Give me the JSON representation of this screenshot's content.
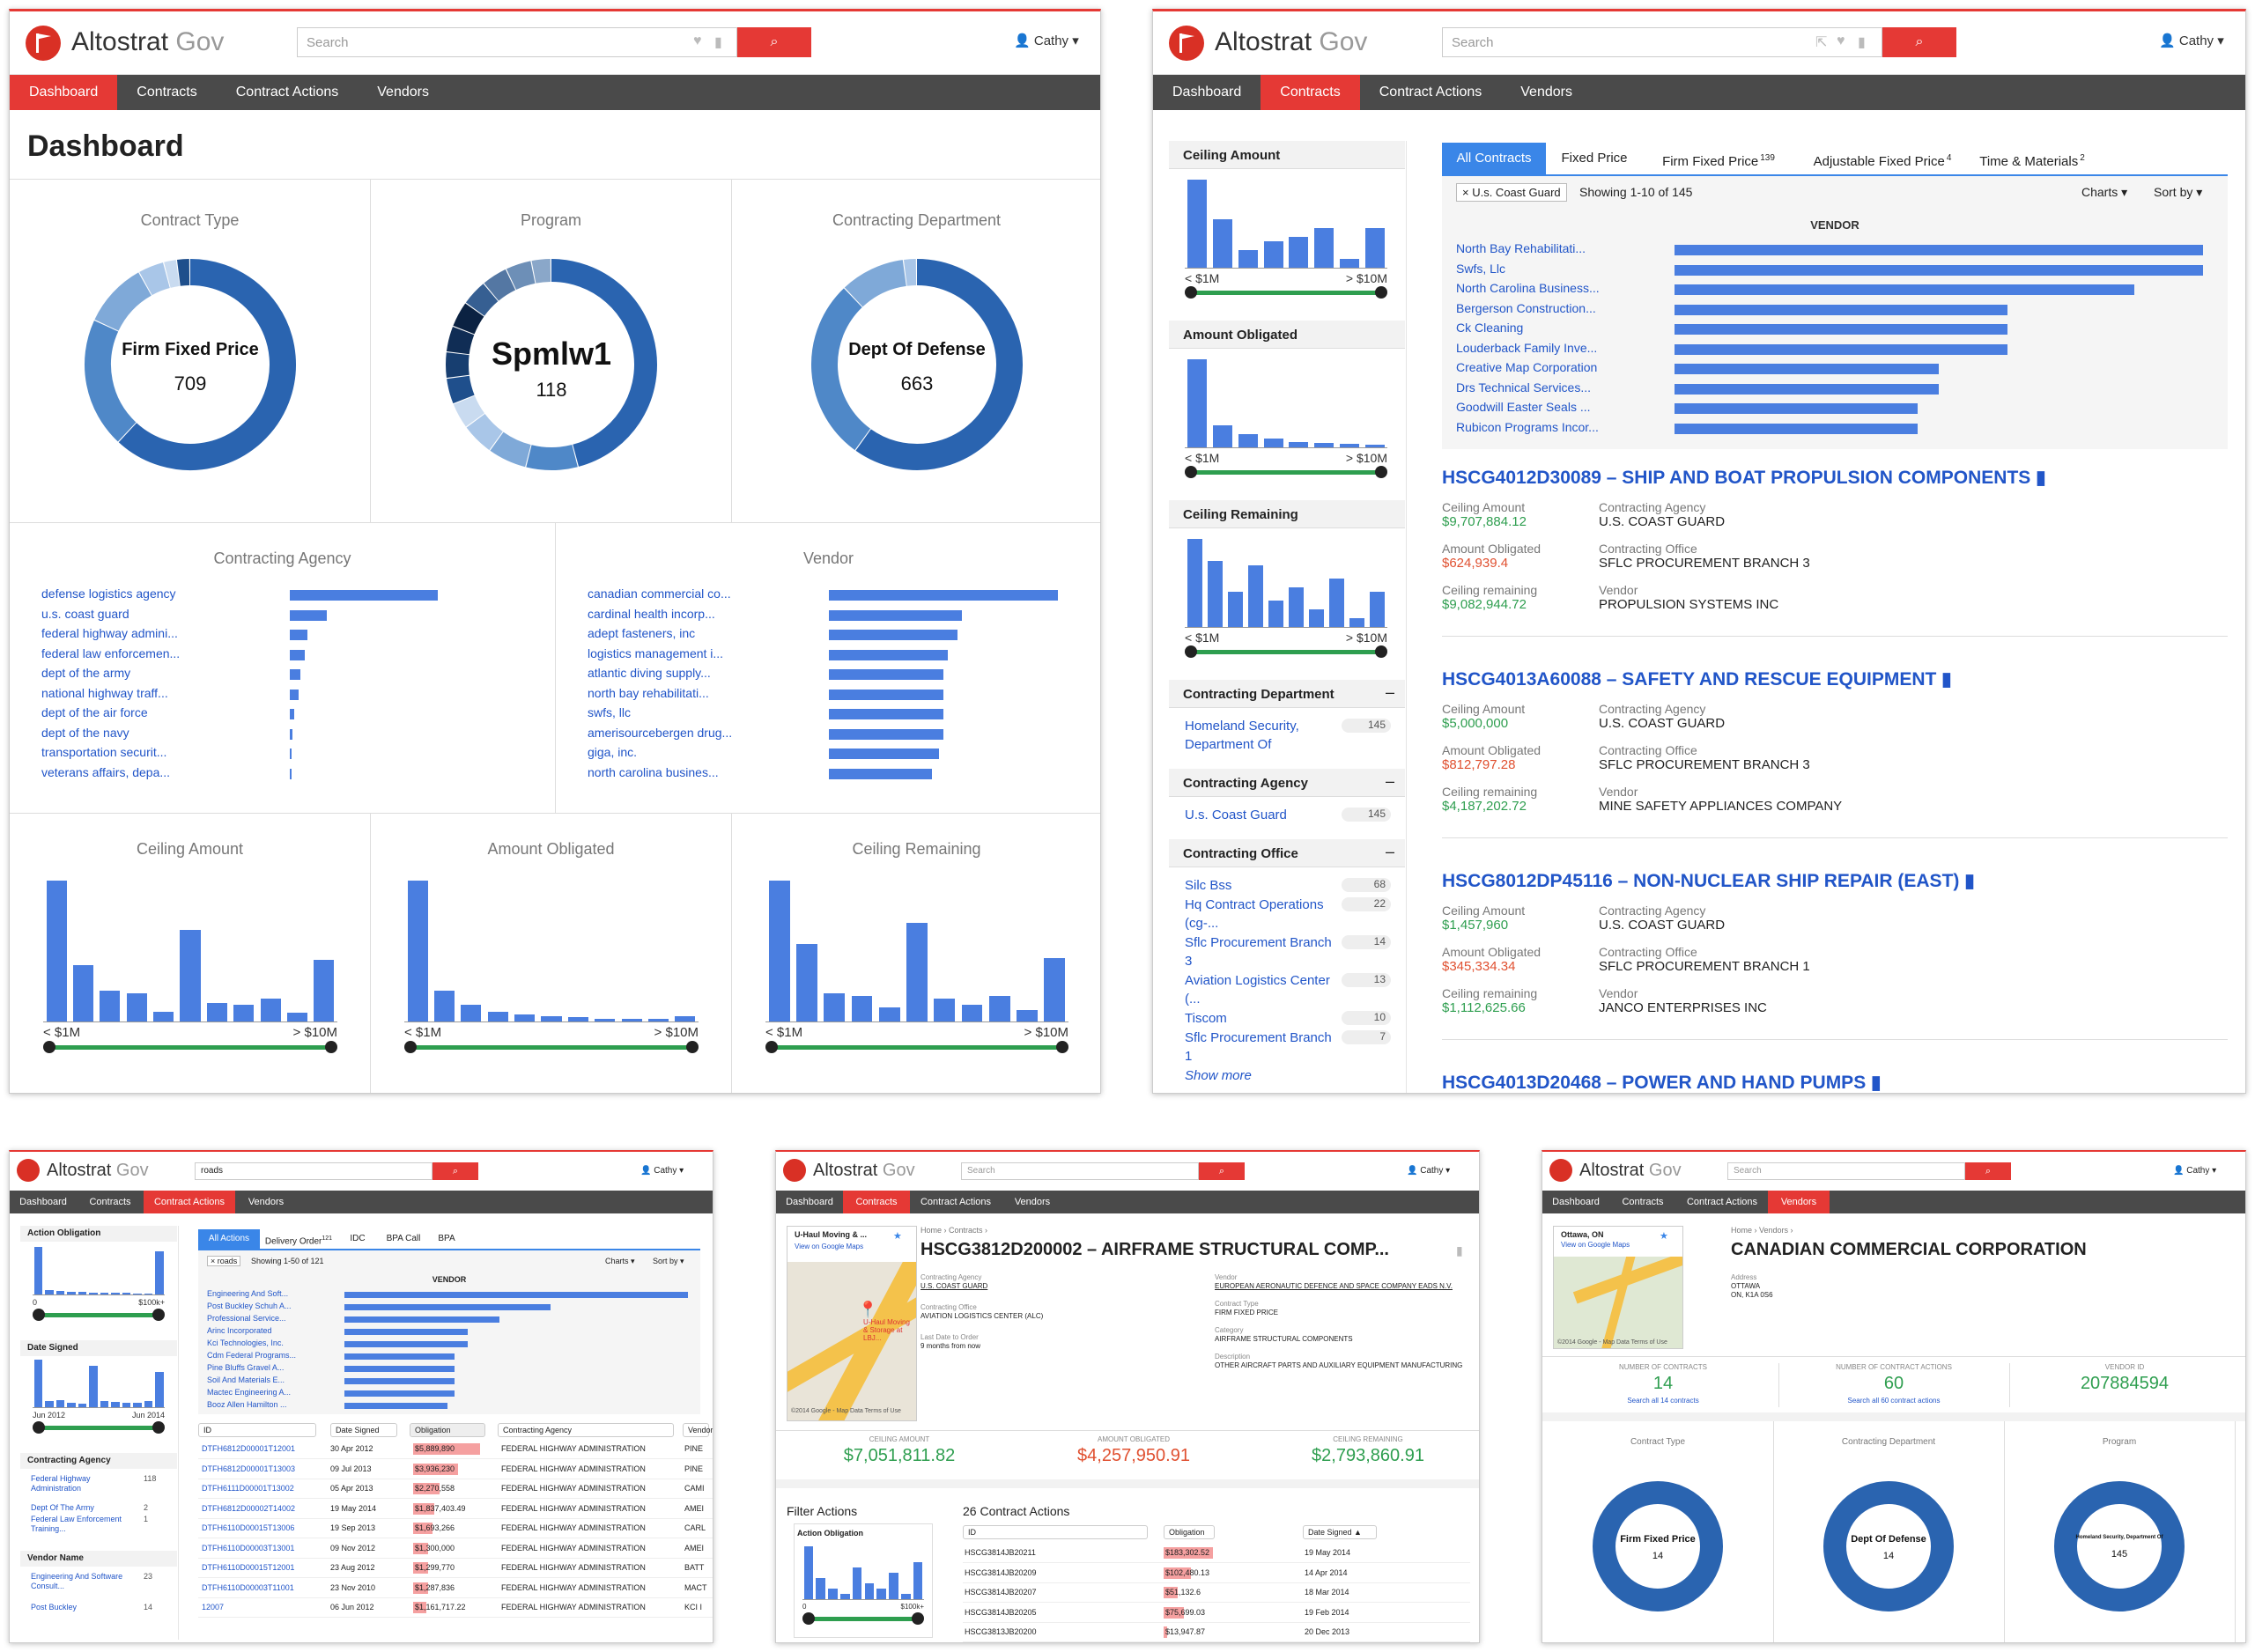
{
  "brand": {
    "name": "Altostrat",
    "suffix": "Gov"
  },
  "search_placeholder": "Search",
  "search_value": "roads",
  "user": "Cathy",
  "nav": [
    "Dashboard",
    "Contracts",
    "Contract Actions",
    "Vendors"
  ],
  "dashboard": {
    "title": "Dashboard",
    "donuts": [
      {
        "title": "Contract Type",
        "label": "Firm Fixed Price",
        "value": "709",
        "segments": [
          0.62,
          0.2,
          0.1,
          0.04,
          0.02,
          0.02
        ]
      },
      {
        "title": "Program",
        "label": "Spmlw1",
        "value": "118",
        "segments": [
          0.46,
          0.08,
          0.06,
          0.05,
          0.04,
          0.04,
          0.04,
          0.04,
          0.04,
          0.04,
          0.04,
          0.04,
          0.03
        ]
      },
      {
        "title": "Contracting Department",
        "label": "Dept Of Defense",
        "value": "663",
        "segments": [
          0.6,
          0.28,
          0.1,
          0.02
        ]
      }
    ],
    "agency": {
      "title": "Contracting Agency",
      "items": [
        "defense logistics agency",
        "u.s. coast guard",
        "federal highway admini...",
        "federal law enforcemen...",
        "dept of the army",
        "national highway traff...",
        "dept of the air force",
        "dept of the navy",
        "transportation securit...",
        "veterans affairs, depa..."
      ],
      "values": [
        1,
        0.25,
        0.12,
        0.1,
        0.07,
        0.06,
        0.03,
        0.02,
        0.01,
        0.005
      ]
    },
    "vendor": {
      "title": "Vendor",
      "items": [
        "canadian commercial co...",
        "cardinal health incorp...",
        "adept fasteners, inc",
        "logistics management i...",
        "atlantic diving supply...",
        "north bay rehabilitati...",
        "swfs, llc",
        "amerisourcebergen drug...",
        "giga, inc.",
        "north carolina busines..."
      ],
      "values": [
        1,
        0.58,
        0.56,
        0.52,
        0.5,
        0.5,
        0.5,
        0.5,
        0.48,
        0.45
      ]
    },
    "hists": [
      {
        "title": "Ceiling Amount",
        "values": [
          100,
          40,
          22,
          20,
          7,
          65,
          13,
          12,
          16,
          6,
          44
        ],
        "lo": "< $1M",
        "hi": "> $10M"
      },
      {
        "title": "Amount Obligated",
        "values": [
          100,
          22,
          12,
          7,
          5,
          4,
          3,
          2,
          2,
          2,
          4
        ],
        "lo": "< $1M",
        "hi": "> $10M"
      },
      {
        "title": "Ceiling Remaining",
        "values": [
          100,
          55,
          20,
          18,
          10,
          70,
          16,
          12,
          18,
          8,
          45
        ],
        "lo": "< $1M",
        "hi": "> $10M"
      }
    ]
  },
  "contracts": {
    "tabs": [
      "All Contracts",
      "Fixed Price",
      "Firm Fixed Price",
      "Adjustable Fixed Price",
      "Time & Materials"
    ],
    "tab_counts": [
      "",
      "",
      "139",
      "4",
      "2"
    ],
    "filter_chip": "U.s. Coast Guard",
    "showing": "Showing 1-10 of 145",
    "charts": "Charts",
    "sortby": "Sort by",
    "vendor_header": "VENDOR",
    "vendors": [
      "North Bay Rehabilitati...",
      "Swfs, Llc",
      "North Carolina Business...",
      "Bergerson Construction...",
      "Ck Cleaning",
      "Louderback Family Inve...",
      "Creative Map Corporation",
      "Drs Technical Services...",
      "Goodwill Easter Seals ...",
      "Rubicon Programs Incor..."
    ],
    "vendor_values": [
      1,
      1,
      0.87,
      0.63,
      0.63,
      0.63,
      0.5,
      0.5,
      0.46,
      0.46
    ],
    "side": {
      "hists": [
        {
          "title": "Ceiling Amount",
          "values": [
            100,
            55,
            20,
            30,
            35,
            45,
            10,
            45
          ],
          "lo": "< $1M",
          "hi": "> $10M"
        },
        {
          "title": "Amount Obligated",
          "values": [
            100,
            25,
            15,
            10,
            6,
            5,
            4,
            3
          ],
          "lo": "< $1M",
          "hi": "> $10M"
        },
        {
          "title": "Ceiling Remaining",
          "values": [
            100,
            75,
            40,
            70,
            30,
            45,
            20,
            55,
            10,
            40
          ],
          "lo": "< $1M",
          "hi": "> $10M"
        }
      ],
      "dept_title": "Contracting Department",
      "dept_items": [
        {
          "label": "Homeland Security, Department Of",
          "count": "145"
        }
      ],
      "agency_title": "Contracting Agency",
      "agency_items": [
        {
          "label": "U.s. Coast Guard",
          "count": "145"
        }
      ],
      "office_title": "Contracting Office",
      "office_items": [
        {
          "label": "Silc Bss",
          "count": "68"
        },
        {
          "label": "Hq Contract Operations (cg-...",
          "count": "22"
        },
        {
          "label": "Sflc Procurement Branch 3",
          "count": "14"
        },
        {
          "label": "Aviation Logistics Center (...",
          "count": "13"
        },
        {
          "label": "Tiscom",
          "count": "10"
        },
        {
          "label": "Sflc Procurement Branch 1",
          "count": "7"
        }
      ],
      "show_more": "Show more"
    },
    "records": [
      {
        "title": "HSCG4012D30089 – SHIP AND BOAT PROPULSION COMPONENTS",
        "ceiling": "$9,707,884.12",
        "obligated": "$624,939.4",
        "remaining": "$9,082,944.72",
        "agency": "U.S. COAST GUARD",
        "office": "SFLC PROCUREMENT BRANCH 3",
        "vendor": "PROPULSION SYSTEMS INC"
      },
      {
        "title": "HSCG4013A60088 – SAFETY AND RESCUE EQUIPMENT",
        "ceiling": "$5,000,000",
        "obligated": "$812,797.28",
        "remaining": "$4,187,202.72",
        "agency": "U.S. COAST GUARD",
        "office": "SFLC PROCUREMENT BRANCH 3",
        "vendor": "MINE SAFETY APPLIANCES COMPANY"
      },
      {
        "title": "HSCG8012DP45116 – NON-NUCLEAR SHIP REPAIR (EAST)",
        "ceiling": "$1,457,960",
        "obligated": "$345,334.34",
        "remaining": "$1,112,625.66",
        "agency": "U.S. COAST GUARD",
        "office": "SFLC PROCUREMENT BRANCH 1",
        "vendor": "JANCO ENTERPRISES INC"
      },
      {
        "title": "HSCG4013D20468 – POWER AND HAND PUMPS"
      }
    ],
    "lbl": {
      "ceiling": "Ceiling Amount",
      "obligated": "Amount Obligated",
      "remaining": "Ceiling remaining",
      "agency": "Contracting Agency",
      "office": "Contracting Office",
      "vendor": "Vendor"
    }
  },
  "actions": {
    "tabs": [
      "All Actions",
      "Delivery Order",
      "IDC",
      "BPA Call",
      "BPA"
    ],
    "tab_counts": [
      "",
      "121",
      "",
      "",
      ""
    ],
    "chip": "roads",
    "showing": "Showing 1-50 of 121",
    "charts": "Charts",
    "sortby": "Sort by",
    "vendor_header": "VENDOR",
    "vendors": [
      "Engineering And Soft...",
      "Post Buckley Schuh A...",
      "Professional Service...",
      "Arinc Incorporated",
      "Kci Technologies, Inc.",
      "Cdm Federal Programs...",
      "Pine Bluffs Gravel A...",
      "Soil And Materials E...",
      "Mactec Engineering A...",
      "Booz Allen Hamilton ..."
    ],
    "vendor_values": [
      1,
      0.6,
      0.45,
      0.36,
      0.36,
      0.32,
      0.32,
      0.32,
      0.32,
      0.3
    ],
    "side_hist1": {
      "title": "Action Obligation",
      "values": [
        100,
        10,
        8,
        6,
        5,
        4,
        4,
        3,
        3,
        2,
        2,
        90
      ],
      "lo": "0",
      "hi": "$100k+"
    },
    "side_hist2": {
      "title": "Date Signed",
      "values": [
        80,
        10,
        12,
        8,
        6,
        70,
        10,
        9,
        8,
        7,
        10,
        60
      ],
      "lo": "Jun 2012",
      "hi": "Jun 2014"
    },
    "side_agency_title": "Contracting Agency",
    "side_agency": [
      {
        "label": "Federal Highway Administration",
        "count": "118"
      },
      {
        "label": "Dept Of The Army",
        "count": "2"
      },
      {
        "label": "Federal Law Enforcement Training...",
        "count": "1"
      }
    ],
    "side_vendor_title": "Vendor Name",
    "side_vendor": [
      {
        "label": "Engineering And Software Consult...",
        "count": "23"
      },
      {
        "label": "Post Buckley",
        "count": "14"
      }
    ],
    "cols": [
      "ID",
      "Date Signed",
      "Obligation",
      "Contracting Agency",
      "Vendor"
    ],
    "rows": [
      [
        "DTFH6812D00001T12001",
        "30 Apr 2012",
        "$5,889,890",
        "FEDERAL HIGHWAY ADMINISTRATION",
        "PINE"
      ],
      [
        "DTFH6812D00001T13003",
        "09 Jul 2013",
        "$3,936,230",
        "FEDERAL HIGHWAY ADMINISTRATION",
        "PINE"
      ],
      [
        "DTFH6111D00001T13002",
        "05 Apr 2013",
        "$2,270,558",
        "FEDERAL HIGHWAY ADMINISTRATION",
        "CAMI"
      ],
      [
        "DTFH6812D00002T14002",
        "19 May 2014",
        "$1,837,403.49",
        "FEDERAL HIGHWAY ADMINISTRATION",
        "AMEI"
      ],
      [
        "DTFH6110D00015T13006",
        "19 Sep 2013",
        "$1,693,266",
        "FEDERAL HIGHWAY ADMINISTRATION",
        "CARL"
      ],
      [
        "DTFH6110D00003T13001",
        "09 Nov 2012",
        "$1,300,000",
        "FEDERAL HIGHWAY ADMINISTRATION",
        "AMEI"
      ],
      [
        "DTFH6110D00015T12001",
        "23 Aug 2012",
        "$1,299,770",
        "FEDERAL HIGHWAY ADMINISTRATION",
        "BATT"
      ],
      [
        "DTFH6110D00003T11001",
        "23 Nov 2010",
        "$1,287,836",
        "FEDERAL HIGHWAY ADMINISTRATION",
        "MACT"
      ],
      [
        "12007",
        "06 Jun 2012",
        "$1,161,717.22",
        "FEDERAL HIGHWAY ADMINISTRATION",
        "KCI I"
      ]
    ],
    "obl_values": [
      1,
      0.67,
      0.39,
      0.31,
      0.29,
      0.22,
      0.22,
      0.22,
      0.2
    ]
  },
  "detail": {
    "map_title": "U-Haul Moving & ...",
    "map_link": "View on Google Maps",
    "map_pin": "U-Haul Moving & Storage at LBJ...",
    "map_credit": "©2014 Google - Map Data   Terms of Use",
    "crumb": "Home › Contracts ›",
    "title": "HSCG3812D200002 – AIRFRAME STRUCTURAL COMP...",
    "fields_left": [
      [
        "Contracting Agency",
        "U.S. COAST GUARD"
      ],
      [
        "Contracting Office",
        "AVIATION LOGISTICS CENTER (ALC)"
      ],
      [
        "Last Date to Order",
        "9 months from now"
      ]
    ],
    "fields_right": [
      [
        "Vendor",
        "EUROPEAN AERONAUTIC DEFENCE AND SPACE COMPANY EADS N.V."
      ],
      [
        "Contract Type",
        "FIRM FIXED PRICE"
      ],
      [
        "Category",
        "AIRFRAME STRUCTURAL COMPONENTS"
      ],
      [
        "Description",
        "OTHER AIRCRAFT PARTS AND AUXILIARY EQUIPMENT MANUFACTURING"
      ]
    ],
    "stats": [
      [
        "CEILING AMOUNT",
        "$7,051,811.82"
      ],
      [
        "AMOUNT OBLIGATED",
        "$4,257,950.91"
      ],
      [
        "CEILING REMAINING",
        "$2,793,860.91"
      ]
    ],
    "filter_title": "Filter Actions",
    "hist": {
      "title": "Action Obligation",
      "values": [
        100,
        40,
        20,
        10,
        60,
        30,
        20,
        50,
        10,
        70
      ],
      "lo": "0",
      "hi": "$100k+"
    },
    "actions_title": "26 Contract Actions",
    "cols": [
      "ID",
      "Obligation",
      "Date Signed"
    ],
    "rows": [
      [
        "HSCG3814JB20211",
        "$183,302.52",
        "19 May 2014"
      ],
      [
        "HSCG3814JB20209",
        "$102,480.13",
        "14 Apr 2014"
      ],
      [
        "HSCG3814JB20207",
        "$51,132.6",
        "18 Mar 2014"
      ],
      [
        "HSCG3814JB20205",
        "$75,699.03",
        "19 Feb 2014"
      ],
      [
        "HSCG3813JB20200",
        "$13,947.87",
        "20 Dec 2013"
      ]
    ],
    "obl_values": [
      1,
      0.56,
      0.28,
      0.41,
      0.08
    ]
  },
  "vendorpage": {
    "map_title": "Ottawa, ON",
    "map_link": "View on Google Maps",
    "map_credit": "©2014 Google - Map Data   Terms of Use",
    "crumb": "Home › Vendors ›",
    "title": "CANADIAN COMMERCIAL CORPORATION",
    "addr_label": "Address",
    "addr1": "OTTAWA",
    "addr2": "ON, K1A 0S6",
    "stats": [
      [
        "NUMBER OF CONTRACTS",
        "14",
        "Search all 14 contracts"
      ],
      [
        "NUMBER OF CONTRACT ACTIONS",
        "60",
        "Search all 60 contract actions"
      ],
      [
        "VENDOR ID",
        "207884594",
        ""
      ]
    ],
    "donuts": [
      {
        "title": "Contract Type",
        "label": "Firm Fixed Price",
        "value": "14"
      },
      {
        "title": "Contracting Department",
        "label": "Dept Of Defense",
        "value": "14"
      },
      {
        "title": "Program",
        "label": "Homeland Security, Department Of",
        "value": "145"
      }
    ]
  },
  "colors": {
    "accent": "#e53935",
    "blue": "#4a7ee0",
    "link": "#2155c8",
    "green": "#2e9e4f",
    "red": "#e05030",
    "navbar": "#4a4a4a"
  }
}
